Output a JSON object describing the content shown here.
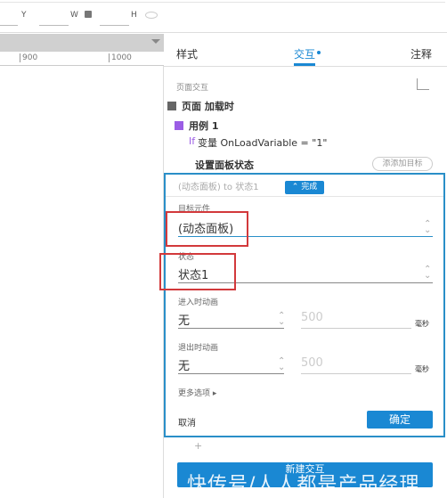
{
  "toolbar": {
    "y_label": "Y",
    "w_label": "W",
    "h_label": "H",
    "lock_icon": "lock-open-icon",
    "eye_icon": "eye-icon"
  },
  "ruler": {
    "ticks": [
      "900",
      "1000"
    ]
  },
  "tabs": [
    {
      "label": "样式"
    },
    {
      "label": "交互",
      "active": true
    },
    {
      "label": "注释"
    }
  ],
  "accent": "#1a88d3",
  "panel": {
    "section_title": "页面交互",
    "event": "页面 加载时",
    "case": "用例 1",
    "condition_if": "If",
    "condition": "变量 OnLoadVariable = \"1\"",
    "action": "设置面板状态",
    "add_target": "添添加目标"
  },
  "editor": {
    "summary": "(动态面板) to 状态1",
    "done": "完成",
    "target_label": "目标元件",
    "target_value": "(动态面板)",
    "state_label": "状态",
    "state_value": "状态1",
    "enter_label": "进入时动画",
    "enter_value": "无",
    "enter_duration": "500",
    "exit_label": "退出时动画",
    "exit_value": "无",
    "exit_duration": "500",
    "ms": "毫秒",
    "more": "更多选项",
    "cancel": "取消",
    "ok": "确定"
  },
  "add_plus": "+",
  "new_interaction": "新建交互",
  "watermark": "快传号/人人都是产品经理"
}
